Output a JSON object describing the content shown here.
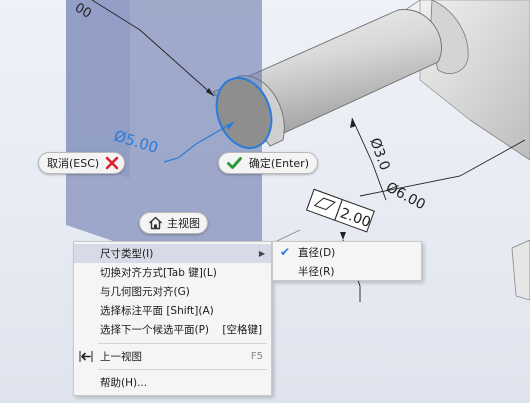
{
  "viewport": {
    "dimension_values": {
      "hole_diameter": "Ø5.00",
      "vertical_diameter": "Ø3.0",
      "diagonal_diameter": "Ø6.00",
      "frame_value": "2.00"
    }
  },
  "mini_toolbar": {
    "cancel_label": "取消(ESC)",
    "ok_label": "确定(Enter)",
    "home_label": "主视图"
  },
  "context_menu": {
    "items": [
      {
        "label": "尺寸类型(I)",
        "has_submenu": true,
        "highlighted": true
      },
      {
        "label": "切换对齐方式[Tab 键](L)"
      },
      {
        "label": "与几何图元对齐(G)"
      },
      {
        "label": "选择标注平面 [Shift](A)"
      },
      {
        "label": "选择下一个候选平面(P)    [空格键]"
      },
      {
        "label": "上一视图",
        "shortcut": "F5",
        "icon": "previous-view-icon"
      },
      {
        "label": "帮助(H)..."
      }
    ]
  },
  "submenu": {
    "items": [
      {
        "label": "直径(D)",
        "checked": true
      },
      {
        "label": "半径(R)",
        "checked": false
      }
    ]
  },
  "colors": {
    "accent": "#2b7bd8",
    "cancel_red": "#e0202a",
    "ok_green": "#2f9a3a",
    "plane": "#5e6fa8"
  }
}
